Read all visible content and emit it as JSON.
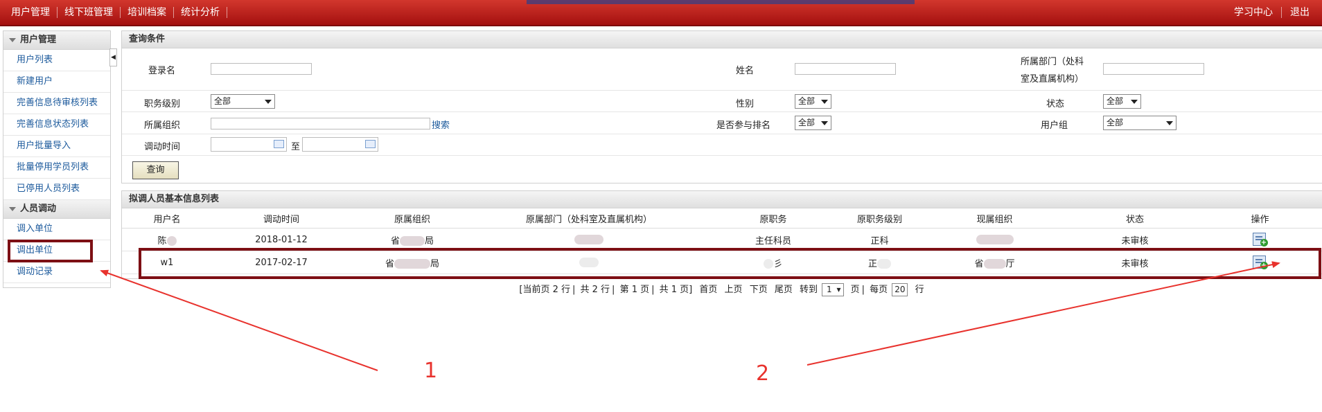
{
  "topnav": {
    "left": [
      "用户管理",
      "线下班管理",
      "培训档案",
      "统计分析"
    ],
    "right": [
      "学习中心",
      "退出"
    ]
  },
  "sidebar": {
    "sections": [
      {
        "title": "用户管理",
        "items": [
          "用户列表",
          "新建用户",
          "完善信息待审核列表",
          "完善信息状态列表",
          "用户批量导入",
          "批量停用学员列表",
          "已停用人员列表"
        ]
      },
      {
        "title": "人员调动",
        "items": [
          "调入单位",
          "调出单位",
          "调动记录"
        ]
      }
    ]
  },
  "query": {
    "title": "查询条件",
    "login_label": "登录名",
    "name_label": "姓名",
    "dept_label_1": "所属部门（处科",
    "dept_label_2": "室及直属机构）",
    "rank_label": "职务级别",
    "rank_value": "全部",
    "gender_label": "性别",
    "gender_value": "全部",
    "status_label": "状态",
    "status_value": "全部",
    "org_label": "所属组织",
    "search_link": "搜索",
    "ranking_label": "是否参与排名",
    "ranking_value": "全部",
    "group_label": "用户组",
    "group_value": "全部",
    "time_label": "调动时间",
    "to_label": "至",
    "query_button": "查询"
  },
  "list": {
    "title": "拟调人员基本信息列表",
    "columns": [
      "用户名",
      "调动时间",
      "原属组织",
      "原属部门（处科室及直属机构）",
      "原职务",
      "原职务级别",
      "现属组织",
      "状态",
      "操作"
    ],
    "rows": [
      {
        "user": "陈",
        "time": "2018-01-12",
        "org_a": "省",
        "org_b": "局",
        "position": "主任科员",
        "rank": "正科",
        "status": "未审核"
      },
      {
        "user": "w1",
        "time": "2017-02-17",
        "org_a": "省",
        "org_b": "局",
        "position_tail": "彡",
        "rank": "正",
        "new_org_a": "省",
        "new_org_b": "厅",
        "status": "未审核"
      }
    ]
  },
  "pager": {
    "current_rows": "[当前页 2 行",
    "total_rows": "共 2 行",
    "page_no": "第 1 页",
    "total_pages": "共 1 页]",
    "first": "首页",
    "prev": "上页",
    "next": "下页",
    "last": "尾页",
    "goto": "转到",
    "goto_value": "1",
    "page_unit": "页",
    "per_page": "每页",
    "per_page_value": "20",
    "row_unit": "行"
  },
  "annotations": {
    "label_1": "1",
    "label_2": "2",
    "color": "#e8322d",
    "box_color": "#7d0f14"
  }
}
